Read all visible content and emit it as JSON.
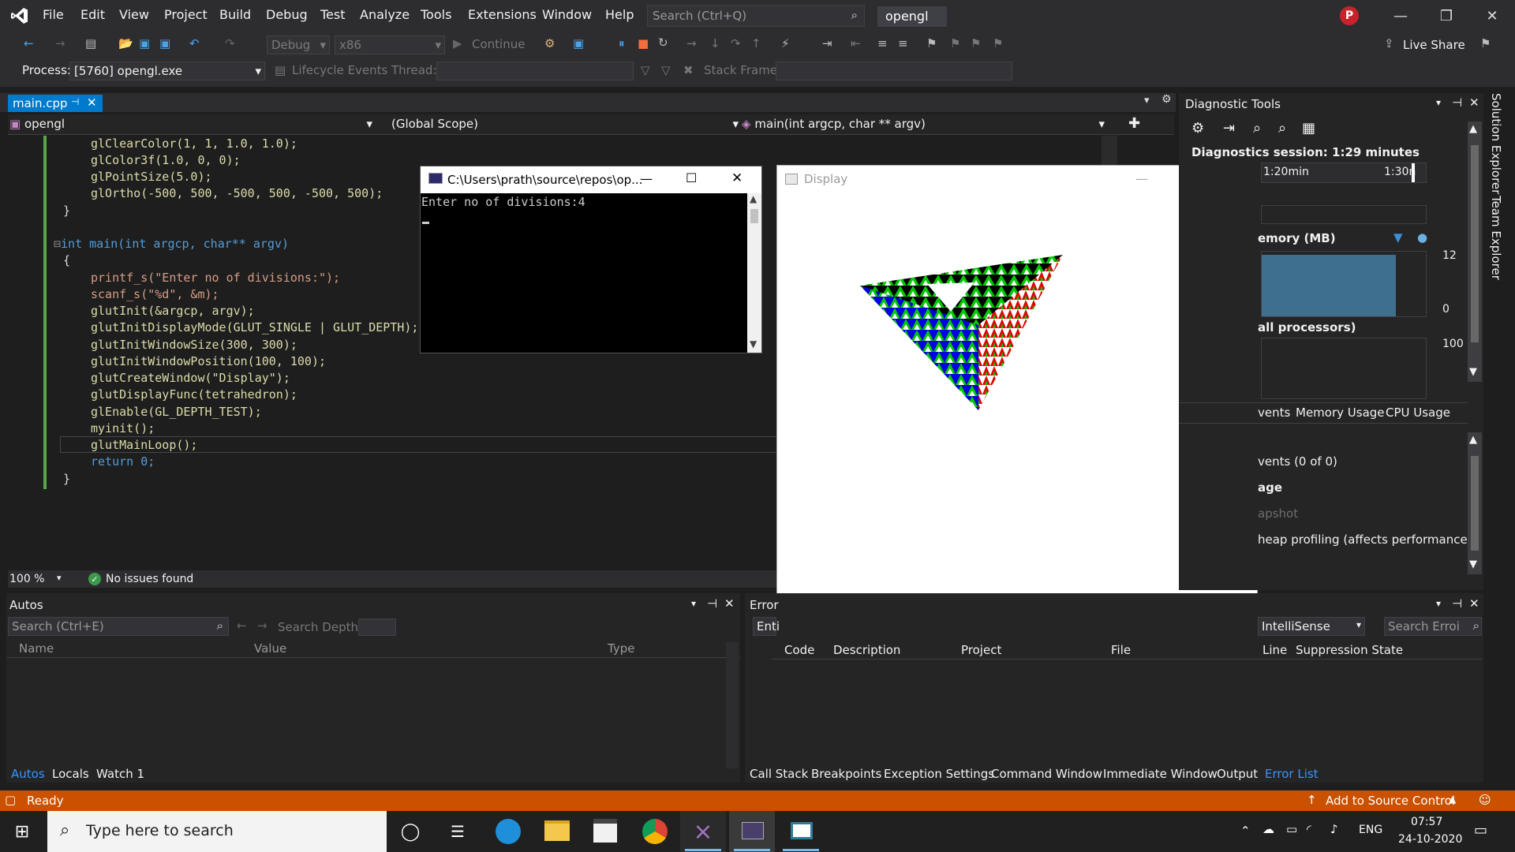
{
  "menu": [
    "File",
    "Edit",
    "View",
    "Project",
    "Build",
    "Debug",
    "Test",
    "Analyze",
    "Tools",
    "Extensions",
    "Window",
    "Help"
  ],
  "search_placeholder": "Search (Ctrl+Q)",
  "project_name": "opengl",
  "avatar_initial": "P",
  "toolbar": {
    "config": "Debug",
    "platform": "x86",
    "continue_label": "Continue",
    "live_share": "Live Share"
  },
  "process_bar": {
    "process_label": "Process:",
    "process_value": "[5760] opengl.exe",
    "lifecycle": "Lifecycle Events",
    "thread_label": "Thread:",
    "stack_frame_label": "Stack Frame:"
  },
  "editor": {
    "tab": "main.cpp",
    "nav_project": "opengl",
    "nav_scope": "(Global Scope)",
    "nav_function": "main(int argcp, char ** argv)",
    "zoom": "100 %",
    "issues": "No issues found"
  },
  "code_lines": [
    "glClearColor(1, 1, 1.0, 1.0);",
    "glColor3f(1.0, 0, 0);",
    "glPointSize(5.0);",
    "glOrtho(-500, 500, -500, 500, -500, 500);",
    "}",
    "",
    "int main(int argcp, char** argv)",
    "{",
    "printf_s(\"Enter no of divisions:\");",
    "scanf_s(\"%d\", &m);",
    "glutInit(&argcp, argv);",
    "glutInitDisplayMode(GLUT_SINGLE | GLUT_DEPTH);",
    "glutInitWindowSize(300, 300);",
    "glutInitWindowPosition(100, 100);",
    "glutCreateWindow(\"Display\");",
    "glutDisplayFunc(tetrahedron);",
    "glEnable(GL_DEPTH_TEST);",
    "myinit();",
    "glutMainLoop();",
    "return 0;",
    "}"
  ],
  "console": {
    "title": "C:\\Users\\prath\\source\\repos\\op...",
    "output": "Enter no of divisions:4"
  },
  "display_window": {
    "title": "Display"
  },
  "diagnostics": {
    "title": "Diagnostic Tools",
    "session": "Diagnostics session: 1:29 minutes",
    "time_1": "1:20min",
    "time_2": "1:30n",
    "memory_label": "emory (MB)",
    "memory_max": "12",
    "memory_min": "0",
    "cpu_label": "all processors)",
    "cpu_max": "100",
    "tabs": [
      "vents",
      "Memory Usage",
      "CPU Usage"
    ],
    "events": "vents (0 of 0)",
    "usage": "age",
    "snapshot": "apshot",
    "heap": "heap profiling (affects performance)"
  },
  "autos": {
    "title": "Autos",
    "search_placeholder": "Search (Ctrl+E)",
    "search_depth": "Search Depth:",
    "columns": [
      "Name",
      "Value",
      "Type"
    ],
    "tabs": [
      "Autos",
      "Locals",
      "Watch 1"
    ]
  },
  "error_list": {
    "title": "Error",
    "scope": "Enti",
    "filter": "IntelliSense",
    "search_placeholder": "Search Erroi",
    "columns": [
      "Code",
      "Description",
      "Project",
      "File",
      "Line",
      "Suppression State"
    ],
    "tabs": [
      "Call Stack",
      "Breakpoints",
      "Exception Settings",
      "Command Window",
      "Immediate Window",
      "Output",
      "Error List"
    ]
  },
  "side_tabs": [
    "Solution Explorer",
    "Team Explorer"
  ],
  "status": {
    "ready": "Ready",
    "source_control": "Add to Source Control"
  },
  "taskbar": {
    "search": "Type here to search",
    "lang": "ENG",
    "time": "07:57",
    "date": "24-10-2020"
  },
  "colors": {
    "accent": "#007acc",
    "status_bar": "#ca5100",
    "editor_bg": "#1e1e1e",
    "chrome_bg": "#2d2d30"
  }
}
